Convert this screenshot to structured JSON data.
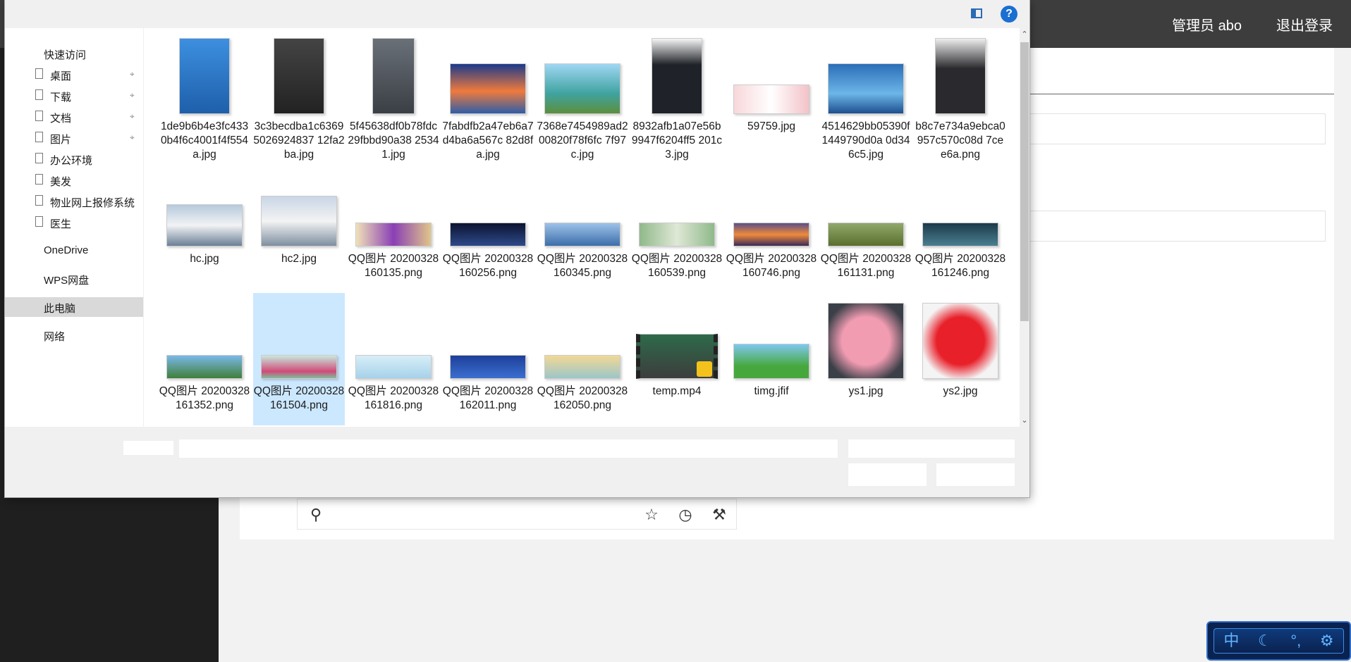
{
  "app": {
    "user_label": "管理员 abo",
    "logout_label": "退出登录"
  },
  "dialog": {
    "nav": {
      "quick_access": "快速访问",
      "items": [
        "桌面",
        "下载",
        "文档",
        "图片",
        "办公环境",
        "美发",
        "物业网上报修系统",
        "医生"
      ],
      "onedrive": "OneDrive",
      "wps": "WPS网盘",
      "this_pc": "此电脑",
      "network": "网络"
    },
    "files": [
      "1de9b6b4e3fc4330b4f6c4001f4f554a.jpg",
      "3c3becdba1c63695026924837 12fa2ba.jpg",
      "5f45638df0b78fdc29fbbd90a38 25341.jpg",
      "7fabdfb2a47eb6a7d4ba6a567c 82d8fa.jpg",
      "7368e7454989ad200820f78f6fc 7f97c.jpg",
      "8932afb1a07e56b9947f6204ff5 201c3.jpg",
      "59759.jpg",
      "4514629bb05390f1449790d0a 0d346c5.jpg",
      "b8c7e734a9ebca0957c570c08d 7cee6a.png",
      "hc.jpg",
      "hc2.jpg",
      "QQ图片 20200328160135.png",
      "QQ图片 20200328160256.png",
      "QQ图片 20200328160345.png",
      "QQ图片 20200328160539.png",
      "QQ图片 20200328160746.png",
      "QQ图片 20200328161131.png",
      "QQ图片 20200328161246.png",
      "QQ图片 20200328161352.png",
      "QQ图片 20200328161504.png",
      "QQ图片 20200328161816.png",
      "QQ图片 20200328162011.png",
      "QQ图片 20200328162050.png",
      "temp.mp4",
      "timg.jfif",
      "ys1.jpg",
      "ys2.jpg"
    ],
    "selected_file_index": 19
  },
  "ime": {
    "mode_label": "中"
  },
  "icons": {
    "help": "?",
    "thumb_kinds": [
      "portrait-photo",
      "landscape-photo",
      "video",
      "flower-photo"
    ]
  }
}
